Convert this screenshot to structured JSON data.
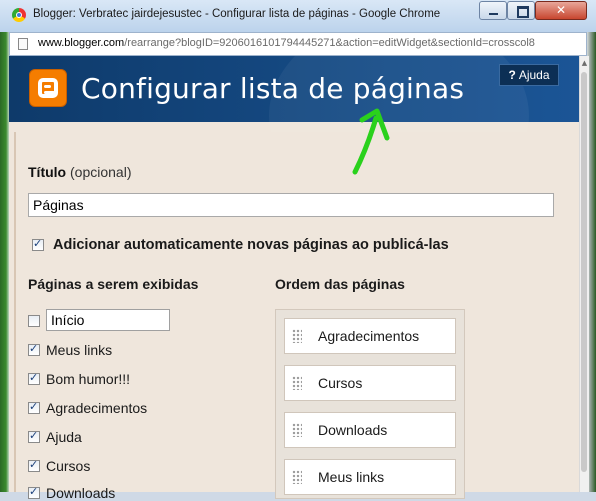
{
  "window": {
    "title": "Blogger: Verbratec jairdejesustec - Configurar lista de páginas - Google Chrome",
    "url_host": "www.blogger.com",
    "url_path": "/rearrange?blogID=9206016101794445271&action=editWidget&sectionId=crosscol8"
  },
  "header": {
    "title": "Configurar lista de páginas",
    "help_icon": "?",
    "help_label": "Ajuda"
  },
  "form": {
    "title_label": "Título",
    "title_optional": "(opcional)",
    "title_value": "Páginas",
    "auto_add_label": "Adicionar automaticamente novas páginas ao publicá-las",
    "auto_add_checked": true,
    "pages_heading": "Páginas a serem exibidas",
    "order_heading": "Ordem das páginas",
    "pages": [
      {
        "label": "Início",
        "checked": false,
        "editable": true
      },
      {
        "label": "Meus links",
        "checked": true
      },
      {
        "label": "Bom humor!!!",
        "checked": true
      },
      {
        "label": "Agradecimentos",
        "checked": true
      },
      {
        "label": "Ajuda",
        "checked": true
      },
      {
        "label": "Cursos",
        "checked": true
      },
      {
        "label": "Downloads",
        "checked": true
      }
    ],
    "order": [
      "Agradecimentos",
      "Cursos",
      "Downloads",
      "Meus links"
    ]
  },
  "colors": {
    "header_bg": "#164b85",
    "content_bg": "#efe6dc",
    "annotation_arrow": "#2ad11c",
    "blogger_orange": "#f57d00"
  }
}
